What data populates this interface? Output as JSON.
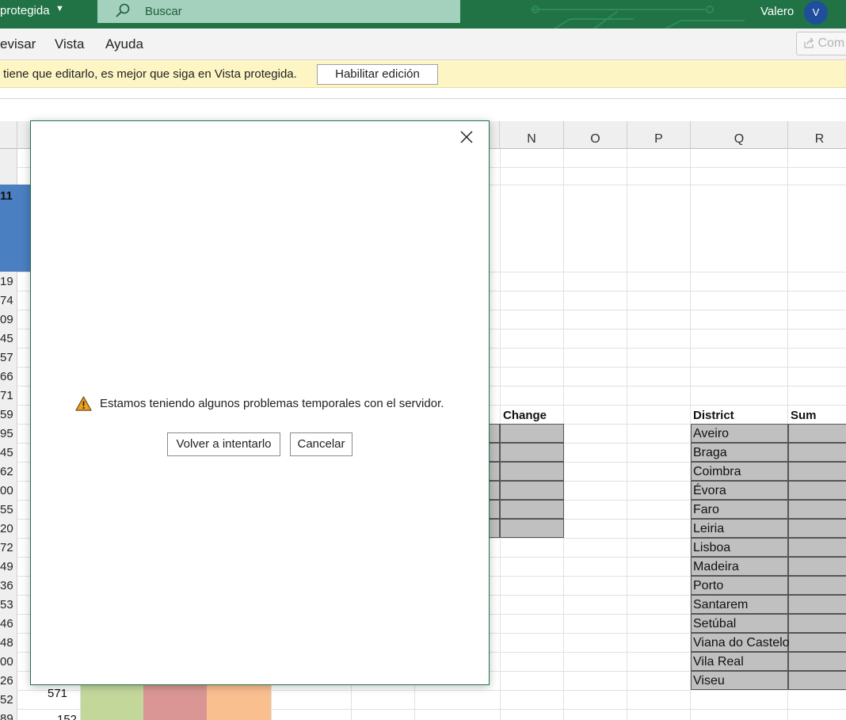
{
  "titlebar": {
    "title": "protegida",
    "search_placeholder": "Buscar",
    "user_name": "Valero",
    "avatar_initial": "V"
  },
  "menu": {
    "items": [
      "evisar",
      "Vista",
      "Ayuda"
    ],
    "share_label": "Com"
  },
  "protected_view": {
    "message": "tiene que editarlo, es mejor que siga en Vista protegida.",
    "enable_label": "Habilitar edición"
  },
  "sheet": {
    "columns": [
      "N",
      "O",
      "P",
      "Q",
      "R"
    ],
    "row_labels": [
      "11",
      "19",
      "74",
      "09",
      "45",
      "57",
      "66",
      "71",
      "59",
      "95",
      "45",
      "62",
      "00",
      "55",
      "20",
      "72",
      "49",
      "36",
      "53",
      "46",
      "48",
      "00",
      "26",
      "52",
      "89"
    ],
    "change_header": "Change",
    "district_header": "District",
    "sum_header": "Sum",
    "districts": [
      "Aveiro",
      "Braga",
      "Coimbra",
      "Évora",
      "Faro",
      "Leiria",
      "Lisboa",
      "Madeira",
      "Porto",
      "Santarem",
      "Setúbal",
      "Viana do Castelo",
      "Vila Real",
      "Viseu"
    ],
    "value_571": "571",
    "value_152": "152"
  },
  "dialog": {
    "message": "Estamos teniendo algunos problemas temporales con el servidor.",
    "retry_label": "Volver a intentarlo",
    "cancel_label": "Cancelar"
  },
  "colors": {
    "excel_green": "#217346",
    "search_bg": "#a4d1bd",
    "avatar_blue": "#1f4e9c",
    "protected_bar": "#fdf6c4",
    "header_blue": "#4a7fc1",
    "cell_gray": "#c0c0c0",
    "fill_green": "#c4d79b",
    "fill_red": "#da9694",
    "fill_orange": "#fabf8f"
  },
  "icons": [
    "search-icon",
    "chevron-down-icon",
    "share-icon",
    "warning-icon",
    "close-icon"
  ]
}
